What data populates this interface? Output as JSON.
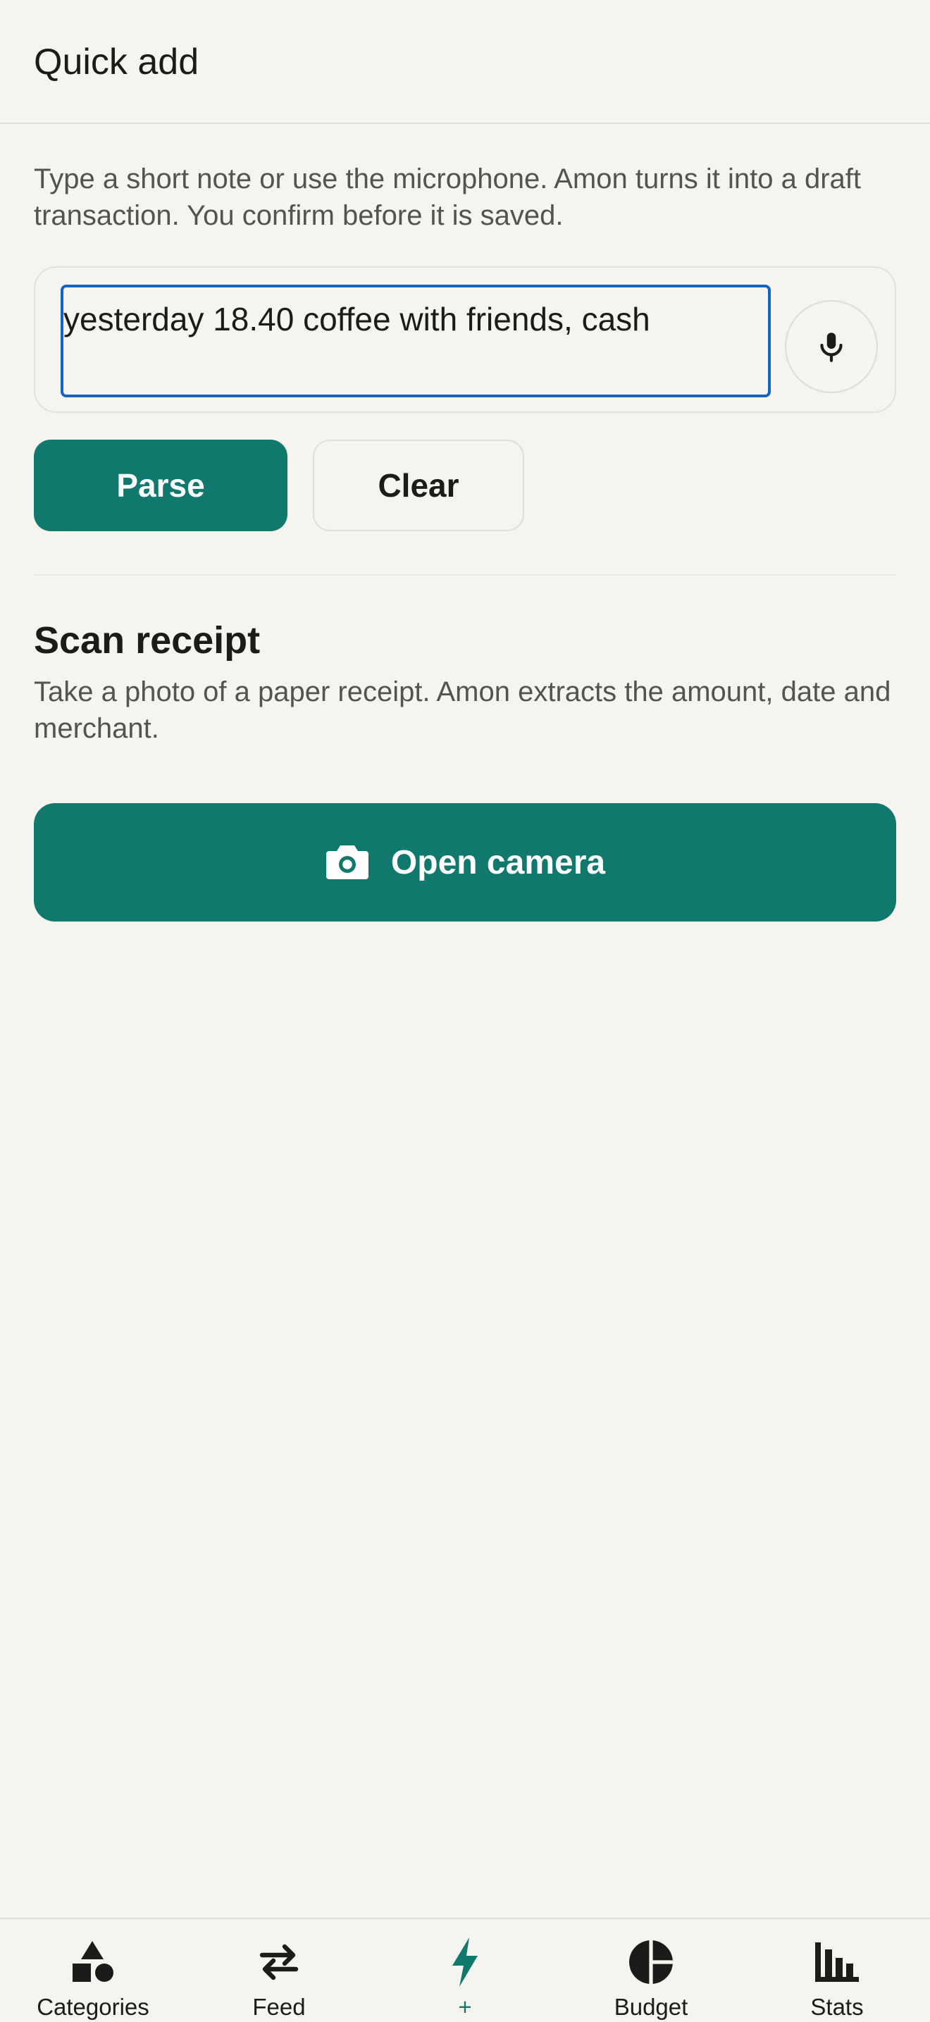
{
  "header": {
    "title": "Quick add"
  },
  "quick_add": {
    "description": "Type a short note or use the microphone. Amon turns it into a draft transaction. You confirm before it is saved.",
    "input_value": "yesterday 18.40 coffee with friends, cash",
    "mic_icon": "microphone-icon",
    "parse_label": "Parse",
    "clear_label": "Clear"
  },
  "scan": {
    "title": "Scan receipt",
    "description": "Take a photo of a paper receipt. Amon extracts the amount, date and merchant.",
    "button_label": "Open camera",
    "button_icon": "camera-icon"
  },
  "nav": {
    "items": [
      {
        "label": "Categories",
        "icon": "shapes-icon"
      },
      {
        "label": "Feed",
        "icon": "swap-arrows-icon"
      },
      {
        "label": "+",
        "icon": "lightning-icon",
        "active": true
      },
      {
        "label": "Budget",
        "icon": "pie-chart-icon"
      },
      {
        "label": "Stats",
        "icon": "bar-chart-icon"
      }
    ]
  },
  "colors": {
    "accent": "#11786e",
    "focus": "#1565c0",
    "background": "#f5f4ef",
    "text": "#1c1b19",
    "muted_text": "#55534e"
  }
}
